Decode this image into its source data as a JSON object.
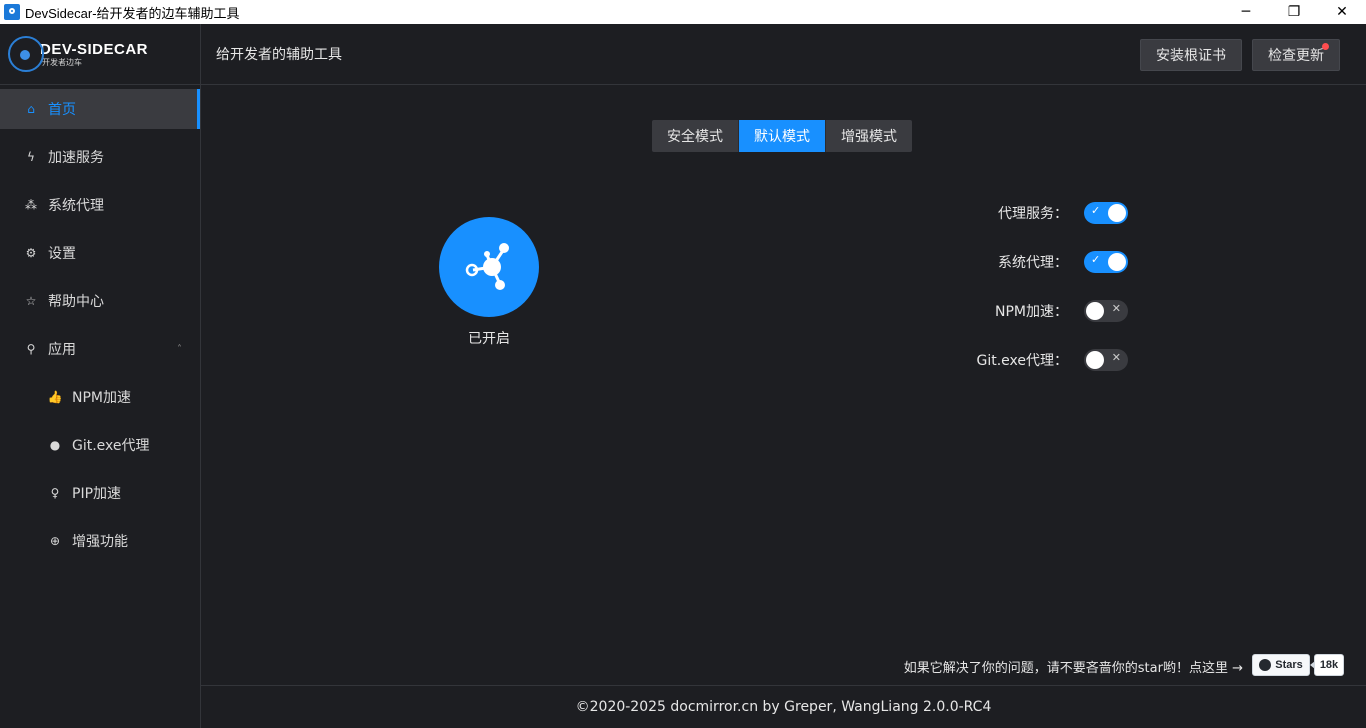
{
  "window": {
    "title": "DevSidecar-给开发者的边车辅助工具",
    "minimize_glyph": "─",
    "restore_glyph": "❐",
    "close_glyph": "✕"
  },
  "logo": {
    "main": "DEV-SIDECAR",
    "sub": "开发者边车"
  },
  "sidebar": {
    "items": [
      {
        "label": "首页",
        "icon": "home-icon",
        "glyph": "⌂",
        "active": true
      },
      {
        "label": "加速服务",
        "icon": "lightning-icon",
        "glyph": "ϟ"
      },
      {
        "label": "系统代理",
        "icon": "cluster-icon",
        "glyph": "⁂"
      },
      {
        "label": "设置",
        "icon": "gear-icon",
        "glyph": "⚙"
      },
      {
        "label": "帮助中心",
        "icon": "star-icon",
        "glyph": "☆"
      },
      {
        "label": "应用",
        "icon": "api-icon",
        "glyph": "⚲",
        "caret": "˄"
      }
    ],
    "sub_items": [
      {
        "label": "NPM加速",
        "icon": "like-icon",
        "glyph": "👍"
      },
      {
        "label": "Git.exe代理",
        "icon": "github-icon",
        "glyph": "●"
      },
      {
        "label": "PIP加速",
        "icon": "bulb-icon",
        "glyph": "♀"
      },
      {
        "label": "增强功能",
        "icon": "global-icon",
        "glyph": "⊕"
      }
    ]
  },
  "header": {
    "title": "给开发者的辅助工具",
    "install_cert_label": "安装根证书",
    "check_update_label": "检查更新"
  },
  "modes": {
    "options": [
      "安全模式",
      "默认模式",
      "增强模式"
    ],
    "selected": "默认模式"
  },
  "power": {
    "status_label": "已开启"
  },
  "toggles": [
    {
      "label": "代理服务：",
      "on": true,
      "inner": "✓"
    },
    {
      "label": "系统代理：",
      "on": true,
      "inner": "✓"
    },
    {
      "label": "NPM加速：",
      "on": false,
      "inner": "✕"
    },
    {
      "label": "Git.exe代理：",
      "on": false,
      "inner": "✕"
    }
  ],
  "star_prompt": {
    "text": "如果它解决了你的问题，请不要吝啬你的star哟！点这里 →",
    "button_label": "Stars",
    "count": "18k"
  },
  "footer": {
    "text": "©2020-2025 docmirror.cn by Greper, WangLiang 2.0.0-RC4"
  },
  "colors": {
    "accent": "#1890ff",
    "background": "#1d1e22",
    "panel": "#3a3b40",
    "badge": "#ff4d4f"
  }
}
